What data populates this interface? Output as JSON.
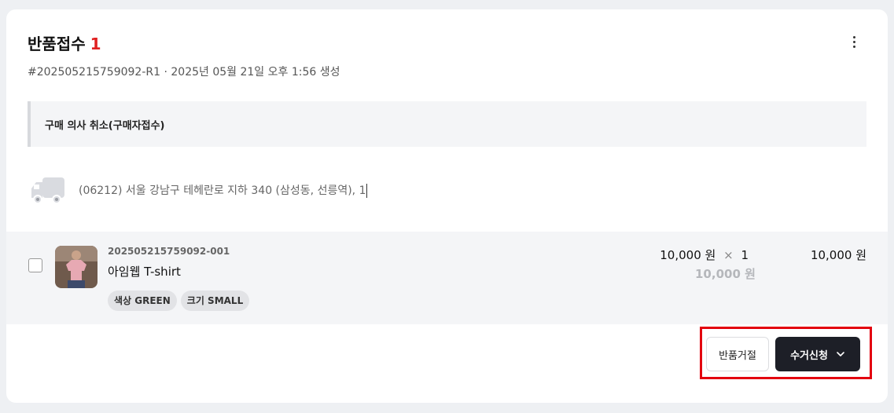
{
  "header": {
    "title": "반품접수",
    "count": "1",
    "meta": "#202505215759092-R1 · 2025년 05월 21일 오후 1:56 생성"
  },
  "notice": {
    "text": "구매 의사 취소(구매자접수)"
  },
  "shipping": {
    "icon": "truck-icon",
    "address": "(06212) 서울 강남구 테헤란로 지하 340 (삼성동, 선릉역), 1"
  },
  "item": {
    "code": "202505215759092-001",
    "name": "아임웹 T-shirt",
    "options": [
      {
        "label": "색상 GREEN"
      },
      {
        "label": "크기 SMALL"
      }
    ],
    "unit_price": "10,000 원",
    "times": "×",
    "quantity": "1",
    "original_price": "10,000 원",
    "total": "10,000 원"
  },
  "actions": {
    "reject_label": "반품거절",
    "pickup_label": "수거신청"
  },
  "colors": {
    "count_red": "#e02020",
    "primary_dark": "#1d1f27",
    "highlight_red": "#e3000f"
  }
}
